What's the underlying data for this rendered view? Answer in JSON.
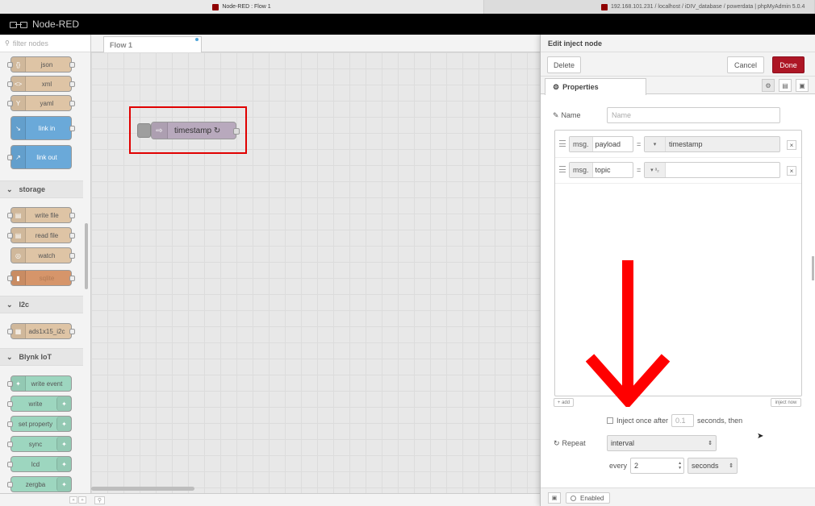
{
  "browser": {
    "tab1": "Node-RED : Flow 1",
    "tab2": "192.168.101.231 / localhost / iDIV_database / powerdata | phpMyAdmin 5.0.4"
  },
  "header": {
    "app_name": "Node-RED"
  },
  "palette": {
    "search_placeholder": "filter nodes",
    "nodes_top": [
      {
        "label": "json",
        "color": "#dec4a5",
        "icon": "braces-icon"
      },
      {
        "label": "xml",
        "color": "#dec4a5",
        "icon": "angle-brackets-icon"
      },
      {
        "label": "yaml",
        "color": "#dec4a5",
        "icon": "yaml-icon"
      },
      {
        "label": "link in",
        "color": "#6aa9d9",
        "icon": "link-in-icon"
      },
      {
        "label": "link out",
        "color": "#6aa9d9",
        "icon": "link-out-icon"
      }
    ],
    "storage": {
      "title": "storage",
      "nodes": [
        {
          "label": "write file",
          "color": "#dec4a5",
          "icon": "file-icon"
        },
        {
          "label": "read file",
          "color": "#dec4a5",
          "icon": "file-icon"
        },
        {
          "label": "watch",
          "color": "#dec4a5",
          "icon": "watch-icon"
        },
        {
          "label": "sqlite",
          "color": "#d6956a",
          "icon": "database-icon"
        }
      ]
    },
    "i2c": {
      "title": "I2c",
      "nodes": [
        {
          "label": "ads1x15_i2c",
          "color": "#dec4a5",
          "icon": "chip-icon"
        }
      ]
    },
    "blynk": {
      "title": "Blynk IoT",
      "nodes": [
        {
          "label": "write event",
          "color": "#9dd6bf"
        },
        {
          "label": "write",
          "color": "#9dd6bf"
        },
        {
          "label": "set property",
          "color": "#9dd6bf"
        },
        {
          "label": "sync",
          "color": "#9dd6bf"
        },
        {
          "label": "lcd",
          "color": "#9dd6bf"
        },
        {
          "label": "zergba",
          "color": "#9dd6bf"
        }
      ]
    }
  },
  "workspace": {
    "tab_label": "Flow 1",
    "node": {
      "label": "timestamp ↻",
      "color": "#b8a9bd"
    }
  },
  "tray": {
    "title": "Edit inject node",
    "delete_label": "Delete",
    "cancel_label": "Cancel",
    "done_label": "Done",
    "tab_properties": "Properties",
    "name_label": "Name",
    "name_placeholder": "Name",
    "props": [
      {
        "prefix": "msg.",
        "key": "payload",
        "value": "timestamp"
      },
      {
        "prefix": "msg.",
        "key": "topic",
        "value": ""
      }
    ],
    "add_label": "+ add",
    "inject_now_label": "inject now",
    "inject_once_label": "Inject once after",
    "inject_once_value": "0.1",
    "inject_once_suffix": "seconds, then",
    "repeat_label": "Repeat",
    "repeat_value": "interval",
    "every_label": "every",
    "every_value": "2",
    "every_unit": "seconds",
    "enabled_label": "Enabled"
  },
  "colors": {
    "done": "#ad1625",
    "highlight": "#e00000",
    "arrow": "#ff0000"
  }
}
